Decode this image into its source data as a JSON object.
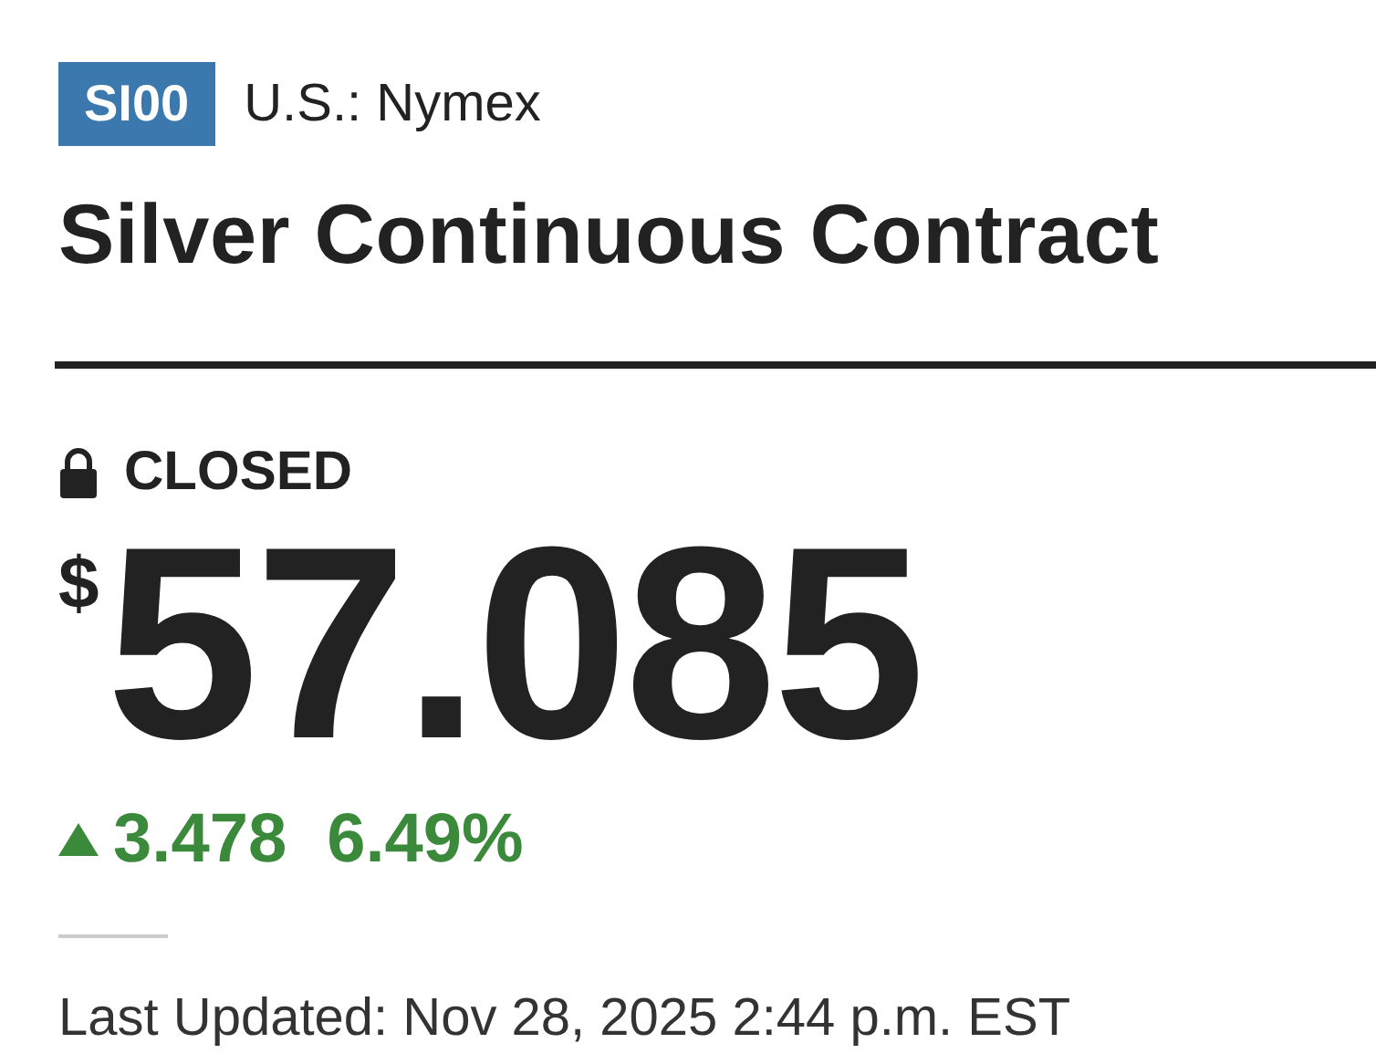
{
  "symbol": "SI00",
  "exchange": "U.S.: Nymex",
  "title": "Silver Continuous Contract",
  "market_status": {
    "label": "CLOSED",
    "locked": true
  },
  "price": {
    "currency": "$",
    "value": "57.085"
  },
  "change": {
    "rising": true,
    "amount": "3.478",
    "percent": "6.49%"
  },
  "last_updated": "Last Updated: Nov 28, 2025 2:44 p.m. EST"
}
